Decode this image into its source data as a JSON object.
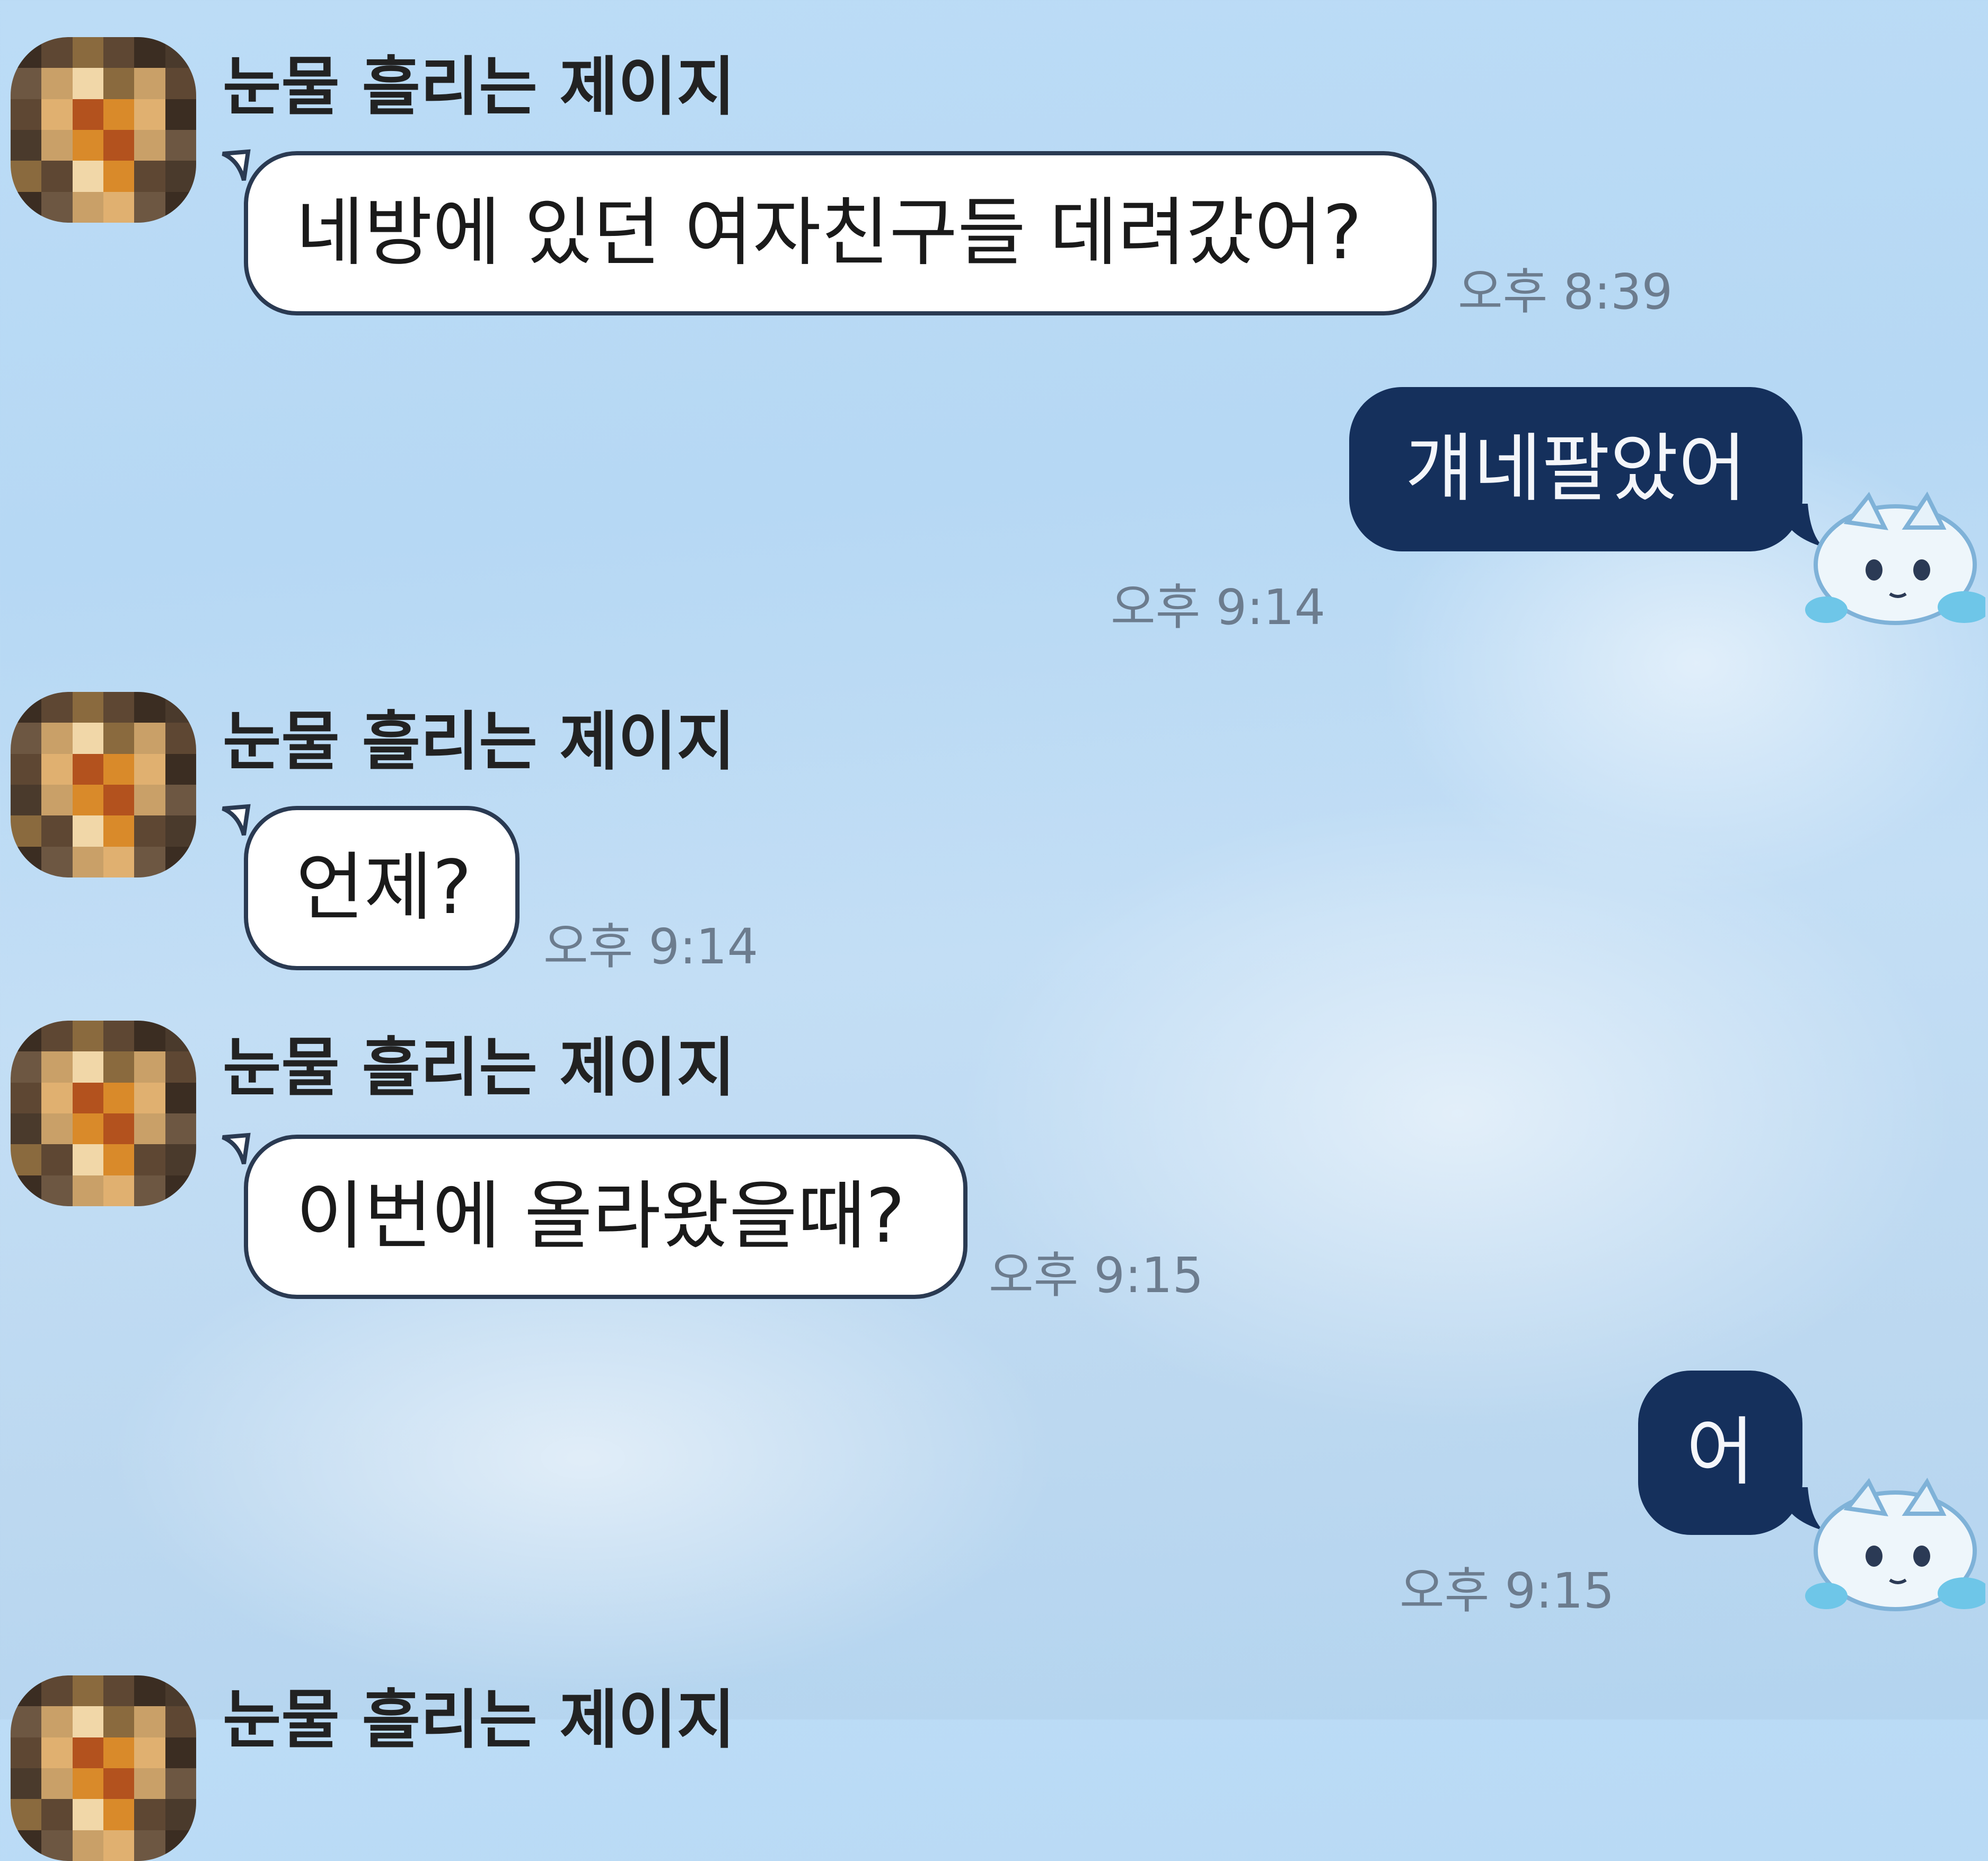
{
  "chat": {
    "messages": [
      {
        "sender": "눈물 흘리는 제이지",
        "text": "네방에 있던 여자친구들 데려갔어?",
        "time": "오후 8:39",
        "side": "incoming"
      },
      {
        "text": "걔네팔았어",
        "time": "오후 9:14",
        "side": "outgoing"
      },
      {
        "sender": "눈물 흘리는 제이지",
        "text": "언제?",
        "time": "오후 9:14",
        "side": "incoming"
      },
      {
        "sender": "눈물 흘리는 제이지",
        "text": "이번에 올라왔을때?",
        "time": "오후 9:15",
        "side": "incoming"
      },
      {
        "text": "어",
        "time": "오후 9:15",
        "side": "outgoing"
      },
      {
        "sender": "눈물 흘리는 제이지",
        "side": "incoming"
      }
    ]
  },
  "icons": {
    "contact_avatar": "pixelated-avatar-icon",
    "own_avatar": "anime-character-sticker-icon"
  },
  "colors": {
    "background": "#bcdcf6",
    "incoming_bubble": "#ffffff",
    "outgoing_bubble": "#15305c",
    "timestamp": "#6c7c8e"
  }
}
